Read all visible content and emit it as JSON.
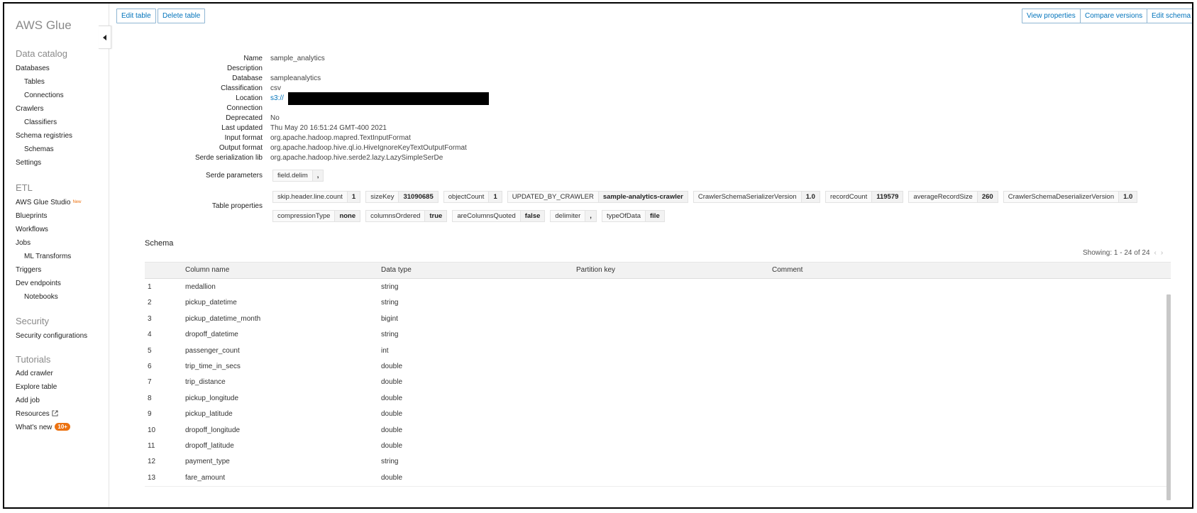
{
  "sidebar": {
    "brand": "AWS Glue",
    "data_catalog": {
      "title": "Data catalog",
      "items": [
        "Databases",
        "Tables",
        "Connections",
        "Crawlers",
        "Classifiers",
        "Schema registries",
        "Schemas",
        "Settings"
      ]
    },
    "etl": {
      "title": "ETL",
      "studio_label": "AWS Glue Studio",
      "studio_tag": "New",
      "items": [
        "Blueprints",
        "Workflows",
        "Jobs",
        "ML Transforms",
        "Triggers",
        "Dev endpoints",
        "Notebooks"
      ]
    },
    "security": {
      "title": "Security",
      "items": [
        "Security configurations"
      ]
    },
    "tutorials": {
      "title": "Tutorials",
      "items": [
        "Add crawler",
        "Explore table",
        "Add job"
      ],
      "resources_label": "Resources",
      "whats_new_label": "What's new",
      "whats_new_badge": "10+"
    }
  },
  "toolbar": {
    "edit_table": "Edit table",
    "delete_table": "Delete table",
    "view_properties": "View properties",
    "compare_versions": "Compare versions",
    "edit_schema": "Edit schema"
  },
  "details": {
    "name": {
      "label": "Name",
      "value": "sample_analytics"
    },
    "description": {
      "label": "Description",
      "value": ""
    },
    "database": {
      "label": "Database",
      "value": "sampleanalytics"
    },
    "classification": {
      "label": "Classification",
      "value": "csv"
    },
    "location": {
      "label": "Location",
      "value": "s3://"
    },
    "connection": {
      "label": "Connection",
      "value": ""
    },
    "deprecated": {
      "label": "Deprecated",
      "value": "No"
    },
    "last_updated": {
      "label": "Last updated",
      "value": "Thu May 20 16:51:24 GMT-400 2021"
    },
    "input_format": {
      "label": "Input format",
      "value": "org.apache.hadoop.mapred.TextInputFormat"
    },
    "output_format": {
      "label": "Output format",
      "value": "org.apache.hadoop.hive.ql.io.HiveIgnoreKeyTextOutputFormat"
    },
    "serde_lib": {
      "label": "Serde serialization lib",
      "value": "org.apache.hadoop.hive.serde2.lazy.LazySimpleSerDe"
    },
    "serde_params": {
      "label": "Serde parameters",
      "key": "field.delim",
      "value": ","
    },
    "table_properties": {
      "label": "Table properties",
      "row1": [
        {
          "k": "skip.header.line.count",
          "v": "1"
        },
        {
          "k": "sizeKey",
          "v": "31090685"
        },
        {
          "k": "objectCount",
          "v": "1"
        },
        {
          "k": "UPDATED_BY_CRAWLER",
          "v": "sample-analytics-crawler"
        },
        {
          "k": "CrawlerSchemaSerializerVersion",
          "v": "1.0"
        },
        {
          "k": "recordCount",
          "v": "119579"
        },
        {
          "k": "averageRecordSize",
          "v": "260"
        },
        {
          "k": "CrawlerSchemaDeserializerVersion",
          "v": "1.0"
        }
      ],
      "row2": [
        {
          "k": "compressionType",
          "v": "none"
        },
        {
          "k": "columnsOrdered",
          "v": "true"
        },
        {
          "k": "areColumnsQuoted",
          "v": "false"
        },
        {
          "k": "delimiter",
          "v": ","
        },
        {
          "k": "typeOfData",
          "v": "file"
        }
      ]
    }
  },
  "schema": {
    "title": "Schema",
    "showing": "Showing: 1 - 24 of 24",
    "headers": {
      "column_name": "Column name",
      "data_type": "Data type",
      "partition_key": "Partition key",
      "comment": "Comment"
    },
    "rows": [
      {
        "n": "1",
        "name": "medallion",
        "type": "string"
      },
      {
        "n": "2",
        "name": "pickup_datetime",
        "type": "string"
      },
      {
        "n": "3",
        "name": "pickup_datetime_month",
        "type": "bigint"
      },
      {
        "n": "4",
        "name": "dropoff_datetime",
        "type": "string"
      },
      {
        "n": "5",
        "name": "passenger_count",
        "type": "int"
      },
      {
        "n": "6",
        "name": "trip_time_in_secs",
        "type": "double"
      },
      {
        "n": "7",
        "name": "trip_distance",
        "type": "double"
      },
      {
        "n": "8",
        "name": "pickup_longitude",
        "type": "double"
      },
      {
        "n": "9",
        "name": "pickup_latitude",
        "type": "double"
      },
      {
        "n": "10",
        "name": "dropoff_longitude",
        "type": "double"
      },
      {
        "n": "11",
        "name": "dropoff_latitude",
        "type": "double"
      },
      {
        "n": "12",
        "name": "payment_type",
        "type": "string"
      },
      {
        "n": "13",
        "name": "fare_amount",
        "type": "double"
      }
    ]
  },
  "colors": {
    "link": "#0073bb",
    "accent": "#ec7211"
  }
}
